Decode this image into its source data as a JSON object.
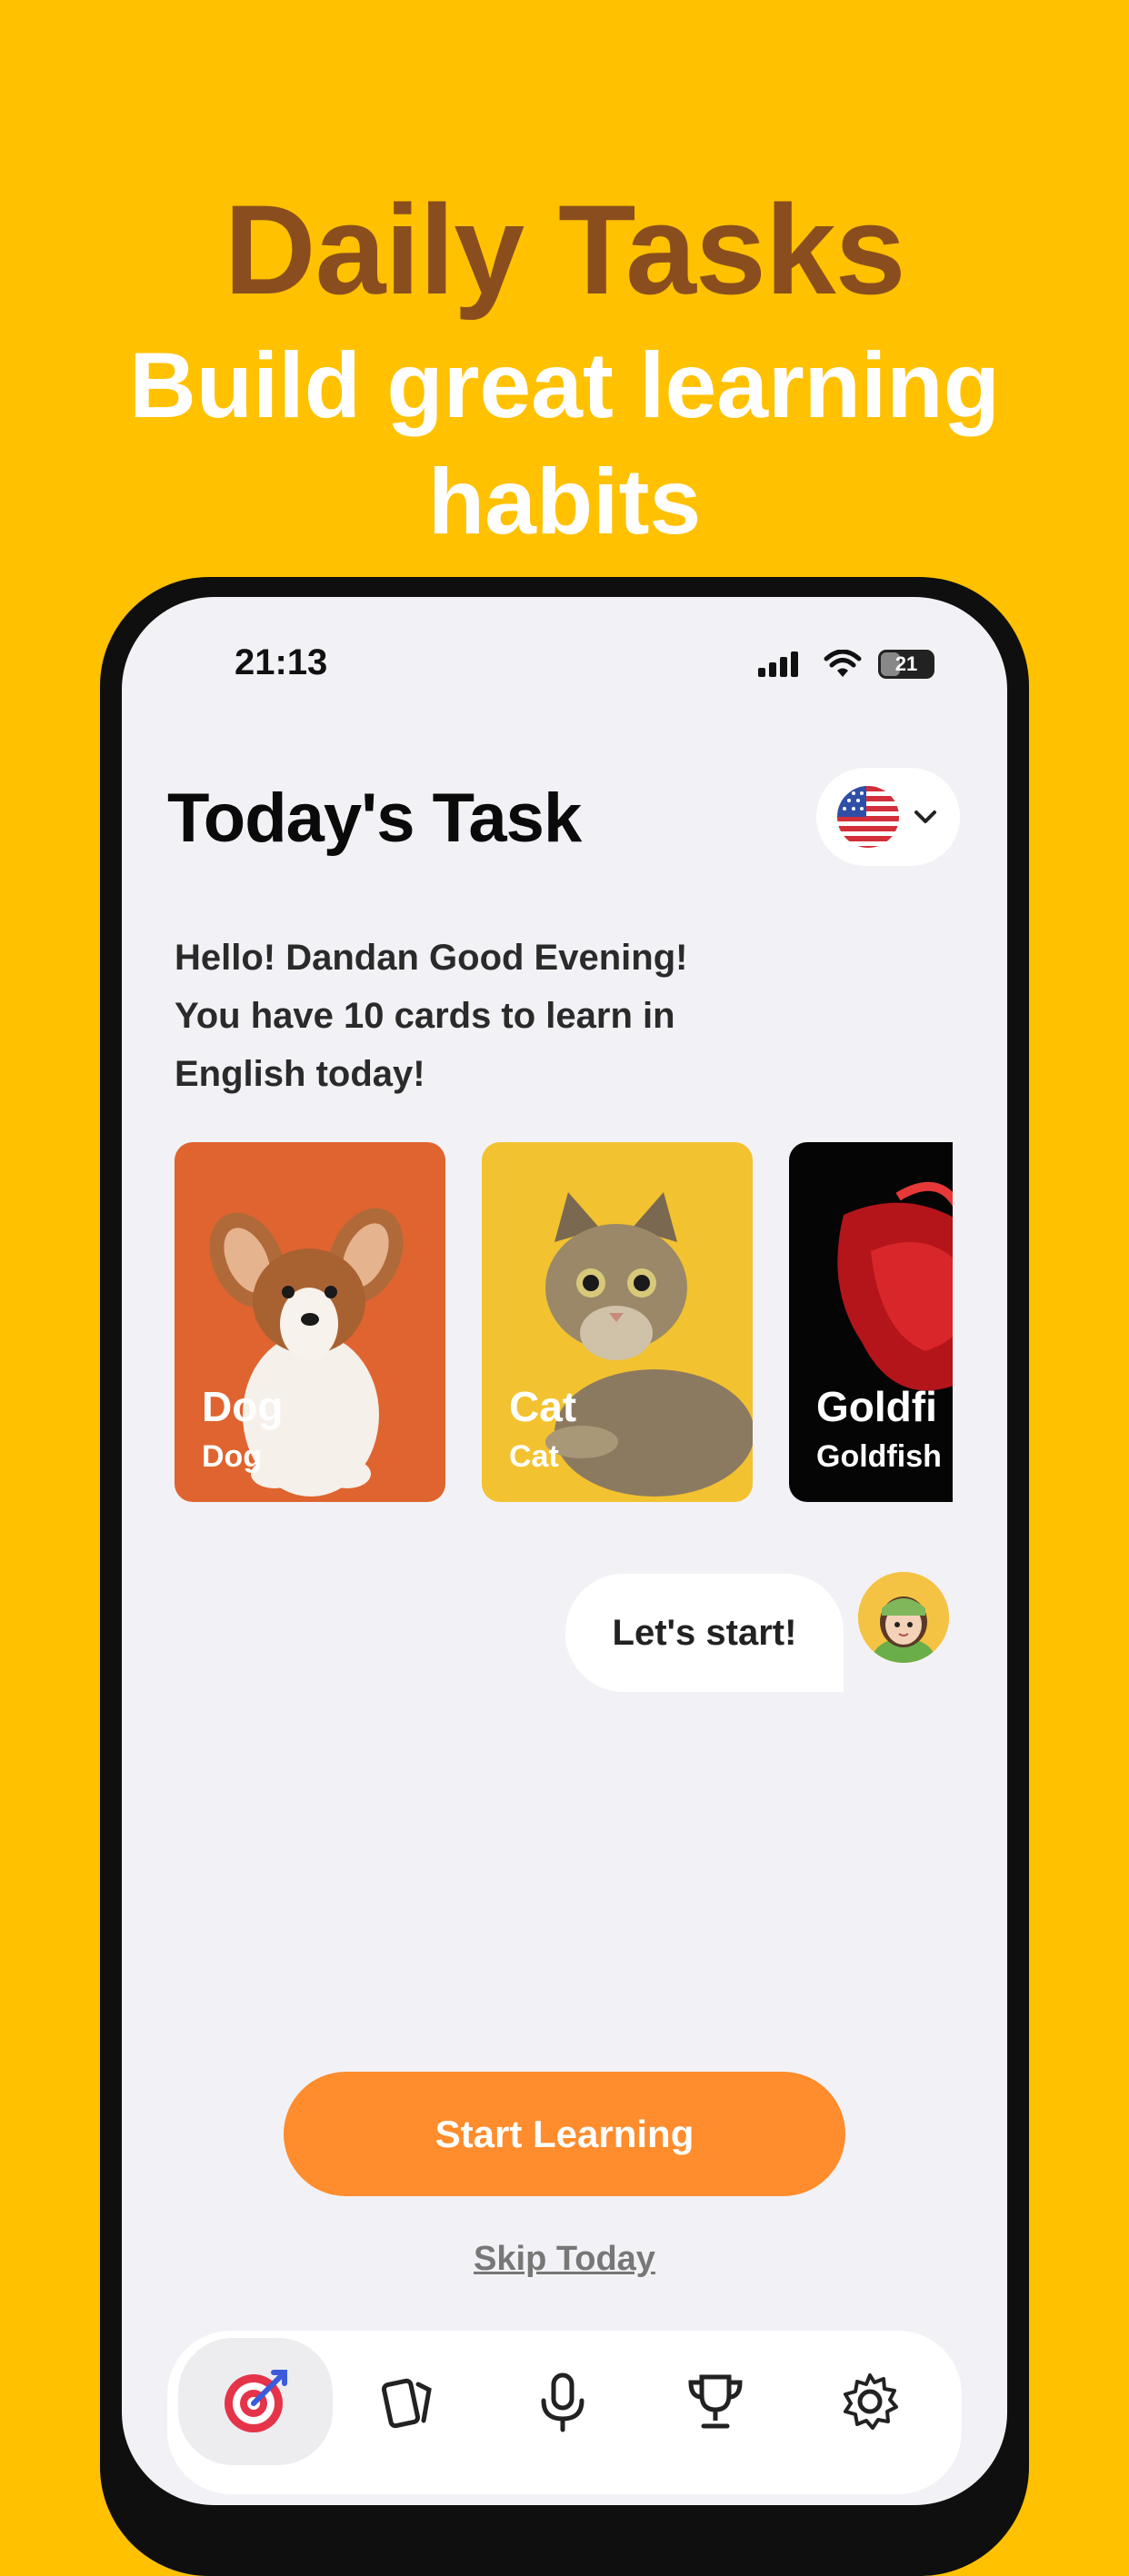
{
  "promo": {
    "headline": "Daily Tasks",
    "subheadline_line1": "Build great learning",
    "subheadline_line2": "habits"
  },
  "status_bar": {
    "time": "21:13",
    "battery": "21"
  },
  "page": {
    "title": "Today's Task",
    "language_flag": "us-flag-icon",
    "greeting_line1": "Hello! Dandan Good Evening!",
    "greeting_line2": "You have 10 cards to learn in",
    "greeting_line3": "English today!"
  },
  "cards": [
    {
      "name": "Dog",
      "translation": "Dog",
      "bg": "#E0642F"
    },
    {
      "name": "Cat",
      "translation": "Cat",
      "bg": "#F2C230"
    },
    {
      "name": "Goldfi",
      "translation": "Goldfish",
      "bg": "#050505"
    }
  ],
  "chat": {
    "message": "Let's start!"
  },
  "actions": {
    "start_label": "Start Learning",
    "skip_label": "Skip Today"
  },
  "tabs": [
    {
      "icon": "target-icon",
      "active": true
    },
    {
      "icon": "cards-icon",
      "active": false
    },
    {
      "icon": "microphone-icon",
      "active": false
    },
    {
      "icon": "trophy-icon",
      "active": false
    },
    {
      "icon": "gear-icon",
      "active": false
    }
  ],
  "colors": {
    "background": "#FFC100",
    "headline": "#8A4E1E",
    "accent_orange": "#FF8C2D"
  }
}
